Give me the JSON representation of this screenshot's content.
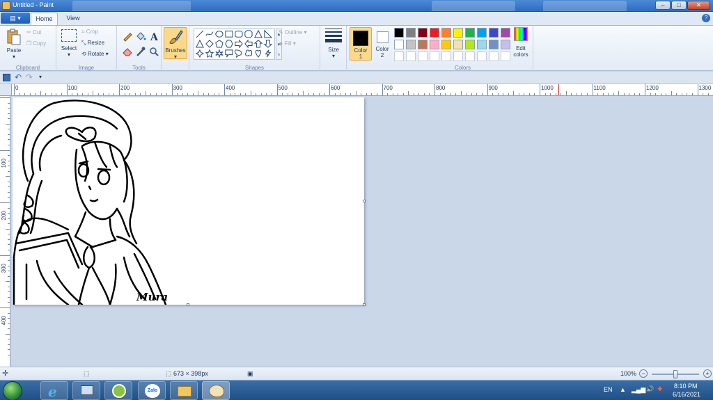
{
  "window": {
    "title": "Untitled - Paint"
  },
  "tabs": [
    {
      "label": "Home"
    },
    {
      "label": "View"
    }
  ],
  "ribbon": {
    "clipboard": {
      "label": "Clipboard",
      "paste": "Paste",
      "cut": "Cut",
      "copy": "Copy"
    },
    "image": {
      "label": "Image",
      "select": "Select",
      "crop": "Crop",
      "resize": "Resize",
      "rotate": "Rotate"
    },
    "tools": {
      "label": "Tools"
    },
    "brushes": {
      "label": "Brushes"
    },
    "shapes": {
      "label": "Shapes",
      "outline": "Outline",
      "fill": "Fill"
    },
    "size": {
      "label": "Size"
    },
    "color1": {
      "label": "Color",
      "num": "1",
      "color": "#000000"
    },
    "color2": {
      "label": "Color",
      "num": "2",
      "color": "#ffffff"
    },
    "colors": {
      "label": "Colors",
      "edit_line1": "Edit",
      "edit_line2": "colors",
      "row1": [
        "#000000",
        "#7f7f7f",
        "#880015",
        "#ed1c24",
        "#ff7f27",
        "#fff200",
        "#22b14c",
        "#00a2e8",
        "#3f48cc",
        "#a349a4"
      ],
      "row2": [
        "#ffffff",
        "#c3c3c3",
        "#b97a57",
        "#ffaec9",
        "#ffc90e",
        "#efe4b0",
        "#b5e61d",
        "#99d9ea",
        "#7092be",
        "#c8bfe7"
      ]
    }
  },
  "rulers": {
    "h_labels": [
      "0",
      "100",
      "200",
      "300",
      "400",
      "500",
      "600",
      "700",
      "800",
      "900",
      "1000",
      "1100",
      "1200",
      "1300"
    ],
    "v_labels": [
      "100",
      "200",
      "300",
      "400"
    ]
  },
  "canvas": {
    "signature": "Mura"
  },
  "status": {
    "canvas_size": "673 × 398px",
    "zoom": "100%"
  },
  "taskbar": {
    "lang": "EN",
    "time": "8:10 PM",
    "date": "6/16/2021"
  }
}
